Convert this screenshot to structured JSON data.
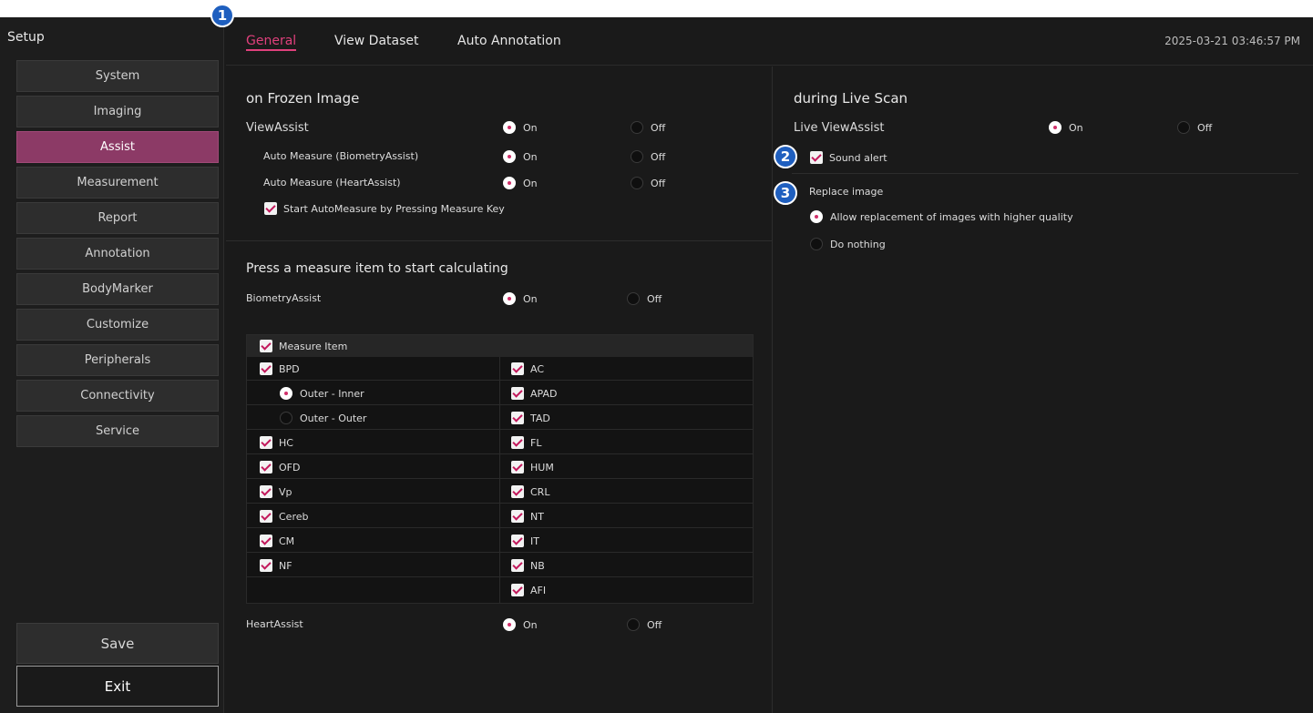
{
  "sidebar": {
    "title": "Setup",
    "items": [
      "System",
      "Imaging",
      "Assist",
      "Measurement",
      "Report",
      "Annotation",
      "BodyMarker",
      "Customize",
      "Peripherals",
      "Connectivity",
      "Service"
    ],
    "active": "Assist",
    "save_label": "Save",
    "exit_label": "Exit"
  },
  "tabs": {
    "general": "General",
    "view_dataset": "View Dataset",
    "auto_annotation": "Auto Annotation"
  },
  "timestamp": "2025-03-21 03:46:57 PM",
  "badges": {
    "b1": "1",
    "b2": "2",
    "b3": "3"
  },
  "frozen": {
    "title": "on Frozen Image",
    "view_assist": "ViewAssist",
    "auto_biometry": "Auto Measure (BiometryAssist)",
    "auto_heart": "Auto Measure (HeartAssist)",
    "start_auto": "Start AutoMeasure by Pressing Measure Key"
  },
  "radio": {
    "on": "On",
    "off": "Off"
  },
  "measure": {
    "title": "Press a measure item to start calculating",
    "biometry": "BiometryAssist",
    "heart": "HeartAssist",
    "header": "Measure Item",
    "left": [
      "BPD",
      "Outer - Inner",
      "Outer - Outer",
      "HC",
      "OFD",
      "Vp",
      "Cereb",
      "CM",
      "NF"
    ],
    "right": [
      "AC",
      "APAD",
      "TAD",
      "FL",
      "HUM",
      "CRL",
      "NT",
      "IT",
      "NB",
      "AFI"
    ]
  },
  "live": {
    "title": "during Live Scan",
    "live_view_assist": "Live ViewAssist",
    "sound_alert": "Sound alert",
    "replace_image": "Replace image",
    "allow_replace": "Allow replacement of images with higher quality",
    "do_nothing": "Do nothing"
  },
  "colors": {
    "accent": "#e0407c",
    "active_nav": "#8c3a66",
    "badge": "#1f5fbf"
  }
}
